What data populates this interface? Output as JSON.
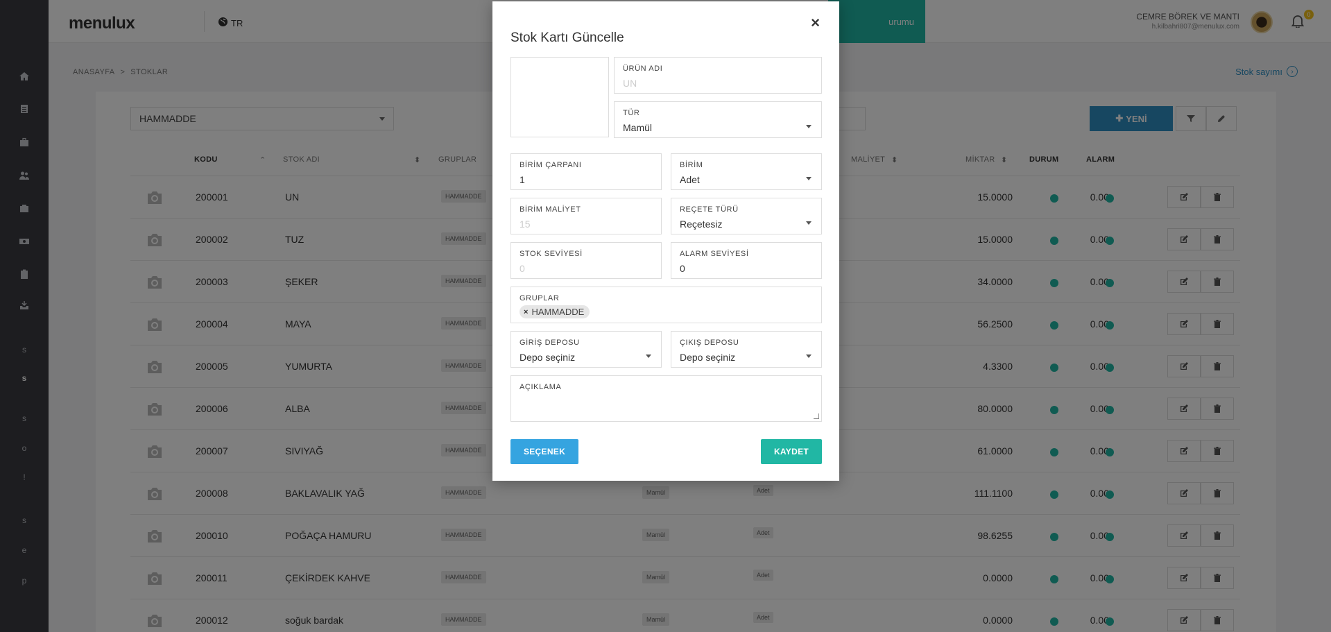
{
  "sidebar": {
    "letters": [
      "s",
      "s",
      "s",
      "o",
      "!",
      "s",
      "e",
      "p"
    ]
  },
  "header": {
    "logo": "menulux",
    "language": "TR",
    "teal_button_partial": "urumu",
    "user_name": "CEMRE BÖREK VE MANTI",
    "user_email": "h.kilbahri807@menulux.com",
    "notification_count": "0"
  },
  "breadcrumb": {
    "home": "ANASAYFA",
    "separator": ">",
    "current": "STOKLAR"
  },
  "stock_count_link": "Stok sayımı",
  "filter": {
    "selected": "HAMMADDE"
  },
  "toolbar": {
    "new_label": "YENİ"
  },
  "table": {
    "headers": {
      "kodu": "KODU",
      "stok_adi": "STOK ADI",
      "gruplar": "GRUPLAR",
      "maliyet": "MALİYET",
      "miktar": "MİKTAR",
      "durum": "DURUM",
      "alarm": "ALARM"
    },
    "rows": [
      {
        "code": "200001",
        "name": "UN",
        "group": "HAMMADDE",
        "type": "",
        "unit": "",
        "cost": "15.0000",
        "qty": "0.00"
      },
      {
        "code": "200002",
        "name": "TUZ",
        "group": "HAMMADDE",
        "type": "",
        "unit": "",
        "cost": "15.0000",
        "qty": "0.00"
      },
      {
        "code": "200003",
        "name": "ŞEKER",
        "group": "HAMMADDE",
        "type": "",
        "unit": "",
        "cost": "34.0000",
        "qty": "0.00"
      },
      {
        "code": "200004",
        "name": "MAYA",
        "group": "HAMMADDE",
        "type": "",
        "unit": "",
        "cost": "56.2500",
        "qty": "0.00"
      },
      {
        "code": "200005",
        "name": "YUMURTA",
        "group": "HAMMADDE",
        "type": "",
        "unit": "",
        "cost": "4.3300",
        "qty": "0.00"
      },
      {
        "code": "200006",
        "name": "ALBA",
        "group": "HAMMADDE",
        "type": "",
        "unit": "",
        "cost": "80.0000",
        "qty": "0.00"
      },
      {
        "code": "200007",
        "name": "SIVIYAĞ",
        "group": "HAMMADDE",
        "type": "",
        "unit": "",
        "cost": "61.0000",
        "qty": "0.00"
      },
      {
        "code": "200008",
        "name": "BAKLAVALIK YAĞ",
        "group": "HAMMADDE",
        "type": "Mamül",
        "unit": "Adet",
        "cost": "111.1100",
        "qty": "0.00"
      },
      {
        "code": "200010",
        "name": "POĞAÇA HAMURU",
        "group": "HAMMADDE",
        "type": "Mamül",
        "unit": "Adet",
        "cost": "98.6255",
        "qty": "0.00"
      },
      {
        "code": "200011",
        "name": "ÇEKİRDEK KAHVE",
        "group": "HAMMADDE",
        "type": "Mamül",
        "unit": "Adet",
        "cost": "0.0000",
        "qty": "0.00"
      },
      {
        "code": "200012",
        "name": "soğuk bardak",
        "group": "HAMMADDE",
        "type": "Mamül",
        "unit": "Adet",
        "cost": "0.0000",
        "qty": "0.00"
      }
    ]
  },
  "modal": {
    "title": "Stok Kartı Güncelle",
    "close": "×",
    "fields": {
      "urun_adi": {
        "label": "ÜRÜN ADI",
        "placeholder": "UN"
      },
      "tur": {
        "label": "TÜR",
        "value": "Mamül"
      },
      "birim_carpani": {
        "label": "BİRİM ÇARPANI",
        "value": "1"
      },
      "birim": {
        "label": "BİRİM",
        "value": "Adet"
      },
      "birim_maliyet": {
        "label": "BİRİM MALİYET",
        "placeholder": "15"
      },
      "recete_turu": {
        "label": "REÇETE TÜRÜ",
        "value": "Reçetesiz"
      },
      "stok_seviyesi": {
        "label": "STOK SEVİYESİ",
        "placeholder": "0"
      },
      "alarm_seviyesi": {
        "label": "ALARM SEVİYESİ",
        "value": "0"
      },
      "gruplar": {
        "label": "GRUPLAR",
        "chip": "HAMMADDE",
        "chip_remove": "×"
      },
      "giris_deposu": {
        "label": "GİRİŞ DEPOSU",
        "value": "Depo seçiniz"
      },
      "cikis_deposu": {
        "label": "ÇIKIŞ DEPOSU",
        "value": "Depo seçiniz"
      },
      "aciklama": {
        "label": "AÇIKLAMA"
      }
    },
    "option_button": "SEÇENEK",
    "save_button": "KAYDET"
  }
}
